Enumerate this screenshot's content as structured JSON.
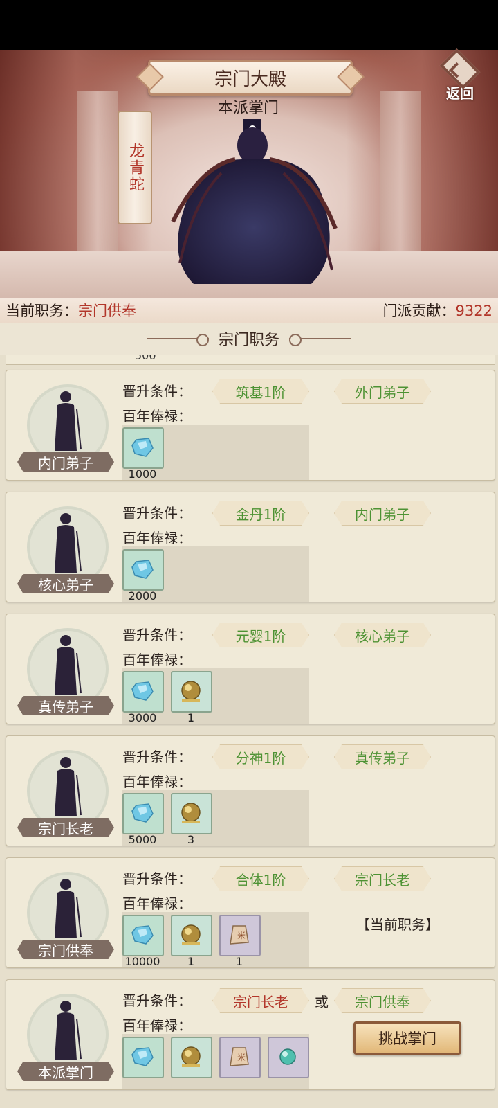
{
  "header": {
    "title": "宗门大殿",
    "back_label": "返回"
  },
  "leader": {
    "title": "本派掌门",
    "name": "龙青蛇"
  },
  "status": {
    "position_key": "当前职务：",
    "position_value": "宗门供奉",
    "contribution_key": "门派贡献：",
    "contribution_value": "9322"
  },
  "section_title": "宗门职务",
  "prev_stub_qty": "500",
  "ranks": [
    {
      "name": "内门弟子",
      "cond_label": "晋升条件：",
      "pay_label": "百年俸禄：",
      "req1": "筑基1阶",
      "req2": "外门弟子",
      "rewards": [
        {
          "icon": "spirit-crystal-icon",
          "qty": "1000"
        }
      ]
    },
    {
      "name": "核心弟子",
      "cond_label": "晋升条件：",
      "pay_label": "百年俸禄：",
      "req1": "金丹1阶",
      "req2": "内门弟子",
      "rewards": [
        {
          "icon": "spirit-crystal-icon",
          "qty": "2000"
        }
      ]
    },
    {
      "name": "真传弟子",
      "cond_label": "晋升条件：",
      "pay_label": "百年俸禄：",
      "req1": "元婴1阶",
      "req2": "核心弟子",
      "rewards": [
        {
          "icon": "spirit-crystal-icon",
          "qty": "3000"
        },
        {
          "icon": "golden-orb-icon",
          "qty": "1"
        }
      ]
    },
    {
      "name": "宗门长老",
      "cond_label": "晋升条件：",
      "pay_label": "百年俸禄：",
      "req1": "分神1阶",
      "req2": "真传弟子",
      "rewards": [
        {
          "icon": "spirit-crystal-icon",
          "qty": "5000"
        },
        {
          "icon": "golden-orb-icon",
          "qty": "3"
        }
      ]
    },
    {
      "name": "宗门供奉",
      "cond_label": "晋升条件：",
      "pay_label": "百年俸禄：",
      "req1": "合体1阶",
      "req2": "宗门长老",
      "rewards": [
        {
          "icon": "spirit-crystal-icon",
          "qty": "10000"
        },
        {
          "icon": "golden-orb-icon",
          "qty": "1"
        },
        {
          "icon": "talisman-icon",
          "qty": "1"
        }
      ],
      "current_label": "【当前职务】"
    },
    {
      "name": "本派掌门",
      "cond_label": "晋升条件：",
      "pay_label": "百年俸禄：",
      "req1": "宗门长老",
      "or_text": "或",
      "req2": "宗门供奉",
      "rewards": [
        {
          "icon": "spirit-crystal-icon",
          "qty": ""
        },
        {
          "icon": "golden-orb-icon",
          "qty": ""
        },
        {
          "icon": "talisman-icon",
          "qty": ""
        },
        {
          "icon": "jade-pearl-icon",
          "qty": ""
        }
      ],
      "challenge_label": "挑战掌门"
    }
  ]
}
